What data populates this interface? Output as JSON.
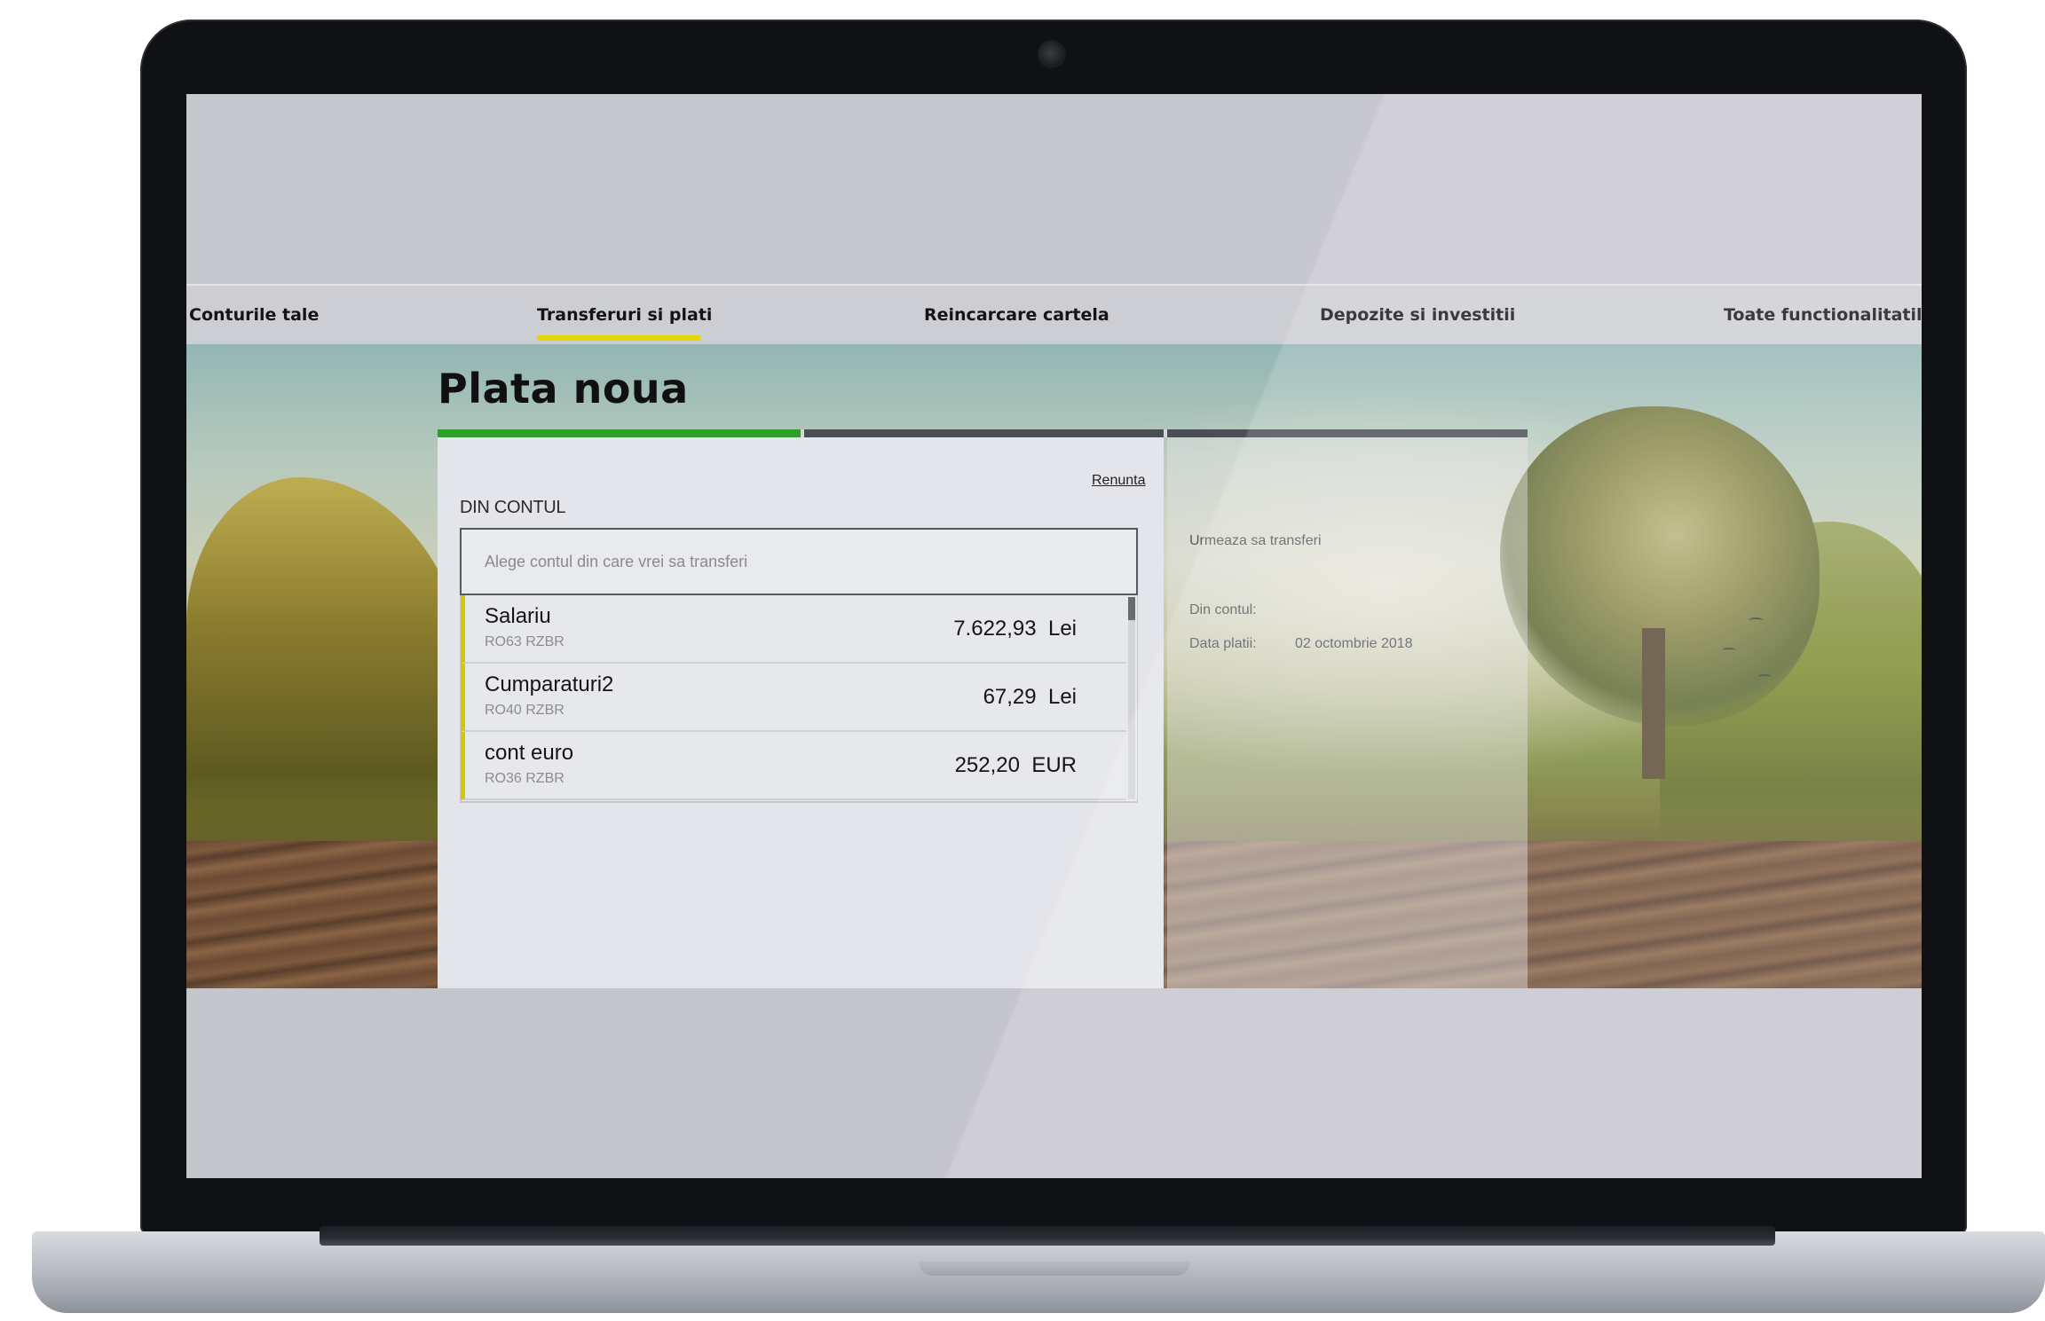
{
  "nav": {
    "items": [
      {
        "label": "Conturile tale"
      },
      {
        "label": "Transferuri si plati"
      },
      {
        "label": "Reincarcare cartela"
      },
      {
        "label": "Depozite si investitii"
      },
      {
        "label": "Toate functionalitatile"
      }
    ],
    "active_index": 1
  },
  "page": {
    "title": "Plata noua"
  },
  "progress": {
    "steps_total": 3,
    "current_step": 1,
    "colors": {
      "done": "#2ea02a",
      "pending": "#4a4e55"
    }
  },
  "form": {
    "cancel_label": "Renunta",
    "from_label": "DIN CONTUL",
    "account_placeholder": "Alege contul din care vrei sa transferi",
    "accounts": [
      {
        "name": "Salariu",
        "iban": "RO63 RZBR",
        "amount": "7.622,93",
        "currency": "Lei"
      },
      {
        "name": "Cumparaturi2",
        "iban": "RO40 RZBR",
        "amount": "67,29",
        "currency": "Lei"
      },
      {
        "name": "cont euro",
        "iban": "RO36 RZBR",
        "amount": "252,20",
        "currency": "EUR"
      }
    ]
  },
  "summary": {
    "heading": "Urmeaza sa transferi",
    "from_label": "Din contul:",
    "date_label": "Data platii:",
    "date_value": "02 octombrie 2018"
  },
  "colors": {
    "accent_yellow": "#e5d600",
    "accent_green": "#2ea02a"
  }
}
